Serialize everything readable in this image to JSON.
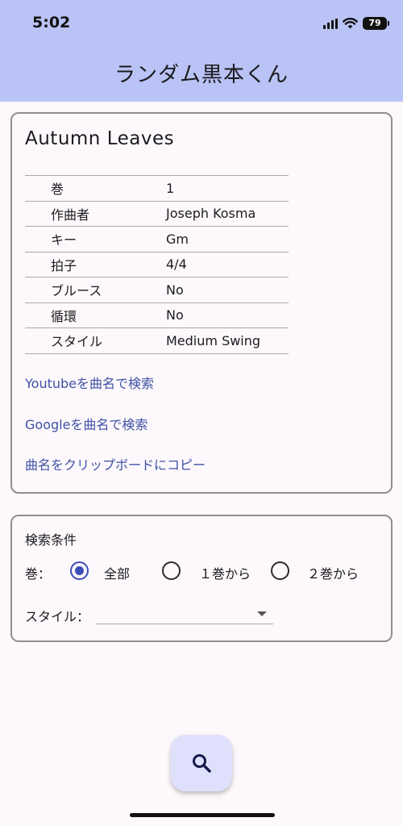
{
  "status_bar": {
    "time": "5:02",
    "battery": "79"
  },
  "app_bar": {
    "title": "ランダム黒本くん"
  },
  "song": {
    "title": "Autumn Leaves",
    "rows": [
      {
        "key": "巻",
        "value": "1"
      },
      {
        "key": "作曲者",
        "value": "Joseph Kosma"
      },
      {
        "key": "キー",
        "value": "Gm"
      },
      {
        "key": "拍子",
        "value": "4/4"
      },
      {
        "key": "ブルース",
        "value": "No"
      },
      {
        "key": "循環",
        "value": "No"
      },
      {
        "key": "スタイル",
        "value": "Medium Swing"
      }
    ],
    "links": {
      "youtube": "Youtubeを曲名で検索",
      "google": "Googleを曲名で検索",
      "copy": "曲名をクリップボードにコピー"
    }
  },
  "search": {
    "heading": "検索条件",
    "volume_label": "巻：",
    "volume_options": [
      {
        "label": "全部",
        "selected": true
      },
      {
        "label": "１巻から",
        "selected": false
      },
      {
        "label": "２巻から",
        "selected": false
      }
    ],
    "style_label": "スタイル：",
    "style_value": ""
  },
  "fab": {
    "icon": "search-icon"
  },
  "colors": {
    "appbar": "#bac3f5",
    "accent": "#3d4db7",
    "link": "#3f51a5",
    "fab": "#dfe0fb"
  }
}
